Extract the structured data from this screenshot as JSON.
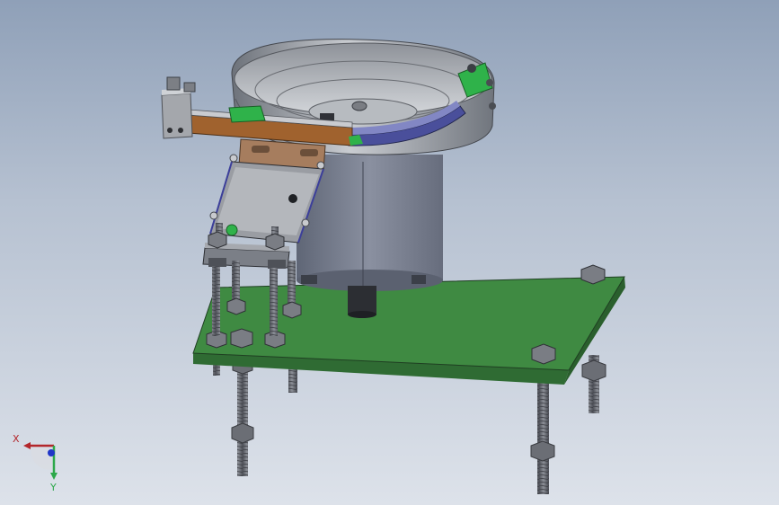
{
  "viewport": {
    "background_top": "#8fa0b8",
    "background_bottom": "#dde2ea"
  },
  "model": {
    "colors": {
      "base_plate": "#3f8a42",
      "base_plate_edge": "#2f6b33",
      "bowl_metal": "#9ea3ab",
      "drive_housing": "#7d8392",
      "track_copper": "#a0622e",
      "track_blue": "#4a4f9b",
      "bracket_steel": "#8c8f95",
      "accent_green": "#2fb24a",
      "bolt_steel": "#6e7178"
    }
  },
  "triad": {
    "x_label": "X",
    "y_label": "Y",
    "x_color": "#b3262b",
    "y_color": "#2ca84a",
    "z_color": "#2036c8"
  }
}
